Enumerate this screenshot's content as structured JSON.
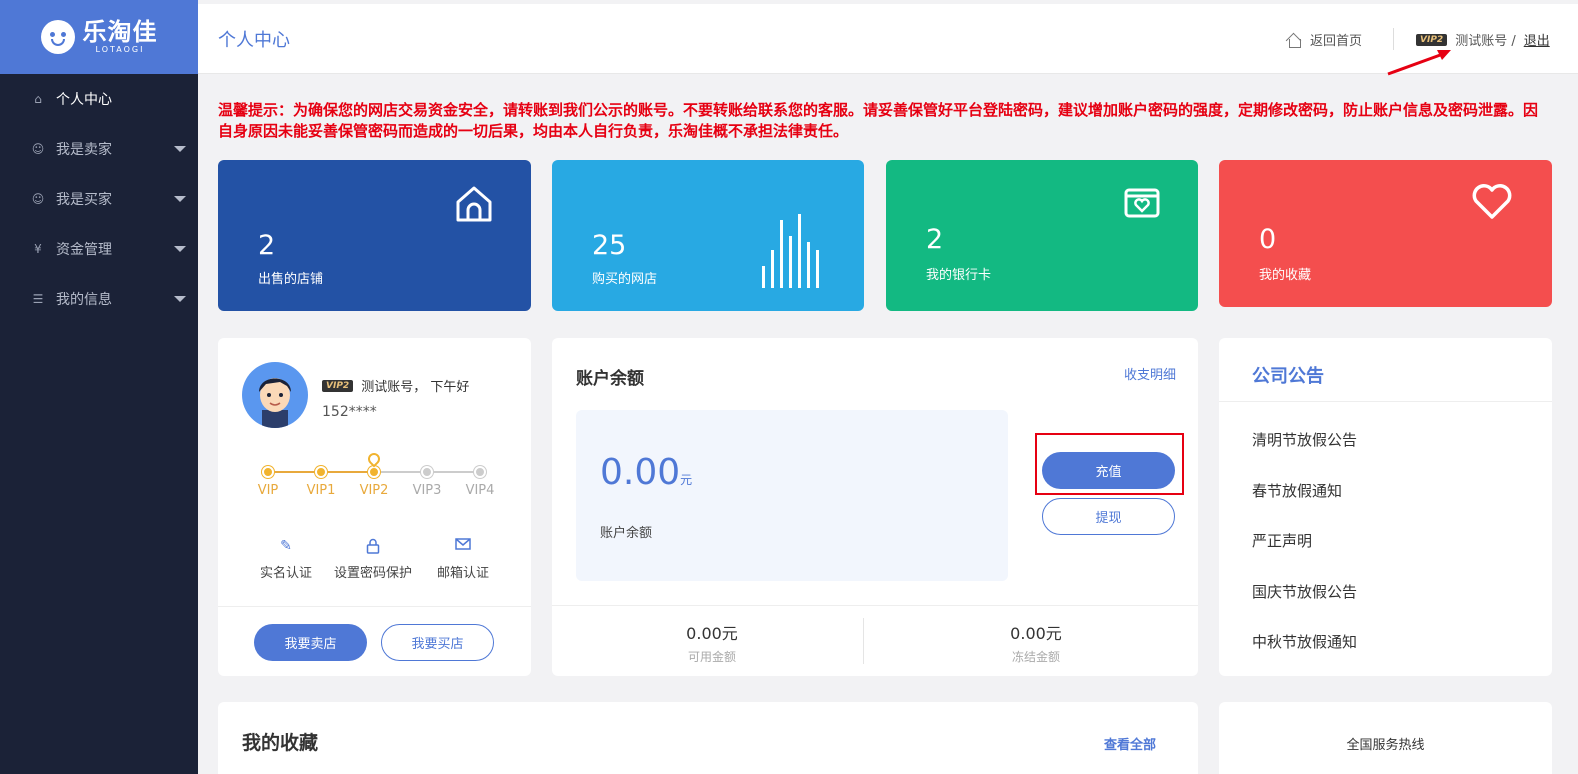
{
  "brand": {
    "name_cn": "乐淘佳",
    "name_en": "LOTAOGI"
  },
  "sidebar": {
    "items": [
      {
        "label": "个人中心"
      },
      {
        "label": "我是卖家"
      },
      {
        "label": "我是买家"
      },
      {
        "label": "资金管理"
      },
      {
        "label": "我的信息"
      }
    ]
  },
  "header": {
    "title": "个人中心",
    "home_link": "返回首页",
    "vip_badge": "VIP2",
    "account": "测试账号 /",
    "logout": "退出"
  },
  "notice_text": "温馨提示：为确保您的网店交易资金安全，请转账到我们公示的账号。不要转账给联系您的客服。请妥善保管好平台登陆密码，建议增加账户密码的强度，定期修改密码，防止账户信息及密码泄露。因自身原因未能妥善保管密码而造成的一切后果，均由本人自行负责，乐淘佳概不承担法律责任。",
  "stats": [
    {
      "value": "2",
      "label": "出售的店铺",
      "color": "#2352a5"
    },
    {
      "value": "25",
      "label": "购买的网店",
      "color": "#28a9e3"
    },
    {
      "value": "2",
      "label": "我的银行卡",
      "color": "#13b982"
    },
    {
      "value": "0",
      "label": "我的收藏",
      "color": "#f44e4e"
    }
  ],
  "user_card": {
    "vip_badge": "VIP2",
    "greeting": "测试账号， 下午好",
    "phone": "152****",
    "vip_levels": [
      "VIP",
      "VIP1",
      "VIP2",
      "VIP3",
      "VIP4"
    ],
    "vip_current_index": 2,
    "verify": [
      {
        "label": "实名认证",
        "icon": "pencil-icon"
      },
      {
        "label": "设置密码保护",
        "icon": "lock-icon"
      },
      {
        "label": "邮箱认证",
        "icon": "mail-icon"
      }
    ],
    "sell_button": "我要卖店",
    "buy_button": "我要买店"
  },
  "balance": {
    "title": "账户余额",
    "detail_link": "收支明细",
    "amount": "0.00",
    "unit": "元",
    "amount_label": "账户余额",
    "recharge_button": "充值",
    "withdraw_button": "提现",
    "available_value": "0.00元",
    "available_label": "可用金额",
    "frozen_value": "0.00元",
    "frozen_label": "冻结金额"
  },
  "announcements": {
    "title": "公司公告",
    "items": [
      "清明节放假公告",
      "春节放假通知",
      "严正声明",
      "国庆节放假公告",
      "中秋节放假通知"
    ]
  },
  "favorites": {
    "title": "我的收藏",
    "view_all": "查看全部"
  },
  "hotline": {
    "label": "全国服务热线"
  },
  "colors": {
    "accent": "#4f78d6",
    "sidebar": "#1b2237",
    "warning": "#e60012",
    "vip_gold": "#f1b32e"
  }
}
